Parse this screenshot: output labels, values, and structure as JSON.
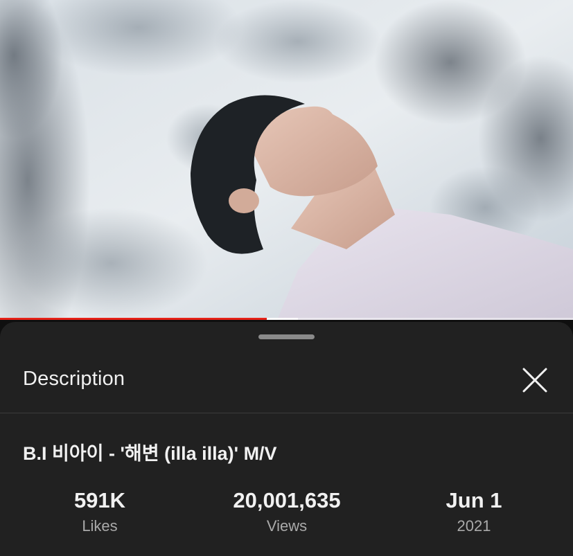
{
  "player": {
    "progress_played": 0.465,
    "progress_buffered": 0.52,
    "colors": {
      "played": "#e62117"
    }
  },
  "description_panel": {
    "title": "Description",
    "close_icon": "close-icon",
    "video_title": "B.I 비아이 - '해변 (illa illa)' M/V",
    "stats": [
      {
        "value": "591K",
        "label": "Likes"
      },
      {
        "value": "20,001,635",
        "label": "Views"
      },
      {
        "value": "Jun 1",
        "label": "2021"
      }
    ]
  }
}
